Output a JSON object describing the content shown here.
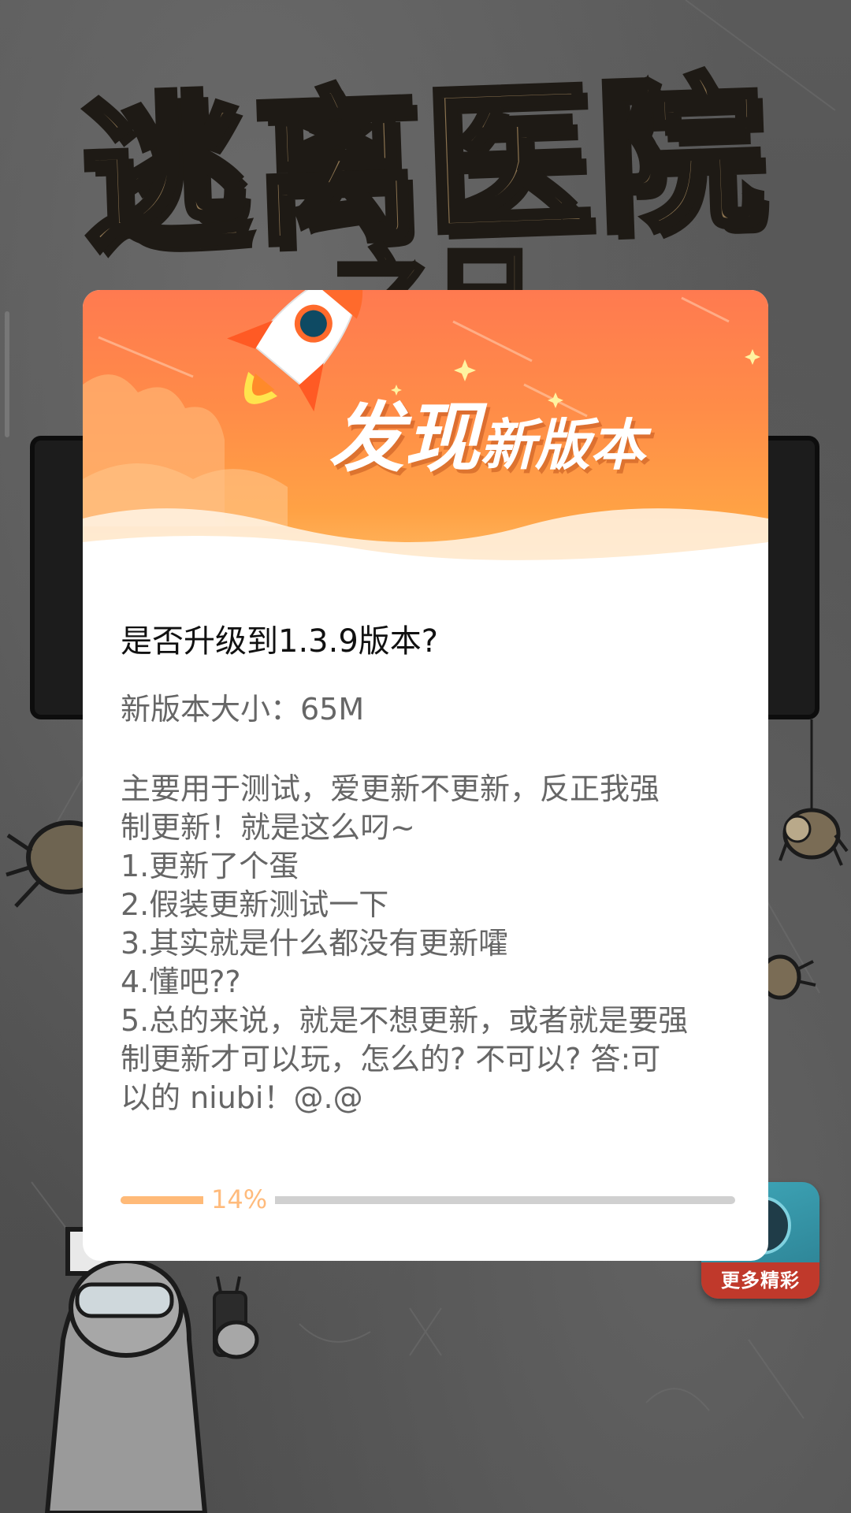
{
  "background": {
    "game_title": "逃离医院",
    "game_subtitle": "之日",
    "more_button_label": "更多精彩"
  },
  "dialog": {
    "banner_title_big": "发现",
    "banner_title_small": "新版本",
    "question": "是否升级到1.3.9版本?",
    "size": "新版本大小：65M",
    "notes": [
      "主要用于测试，爱更新不更新，反正我强",
      "制更新！就是这么叼~",
      "1.更新了个蛋",
      "2.假装更新测试一下",
      "3.其实就是什么都没有更新嚯",
      "4.懂吧??",
      "5.总的来说，就是不想更新，或者就是要强",
      "制更新才可以玩，怎么的? 不可以? 答:可",
      "以的 niubi！@.@"
    ],
    "progress_percent": 14,
    "progress_label": "14%"
  },
  "colors": {
    "banner_top": "#ff7a50",
    "banner_bottom": "#ffbf6a",
    "progress_fill": "#ffba78",
    "progress_track": "#d0d0d0",
    "progress_text": "#ffbb7c"
  }
}
